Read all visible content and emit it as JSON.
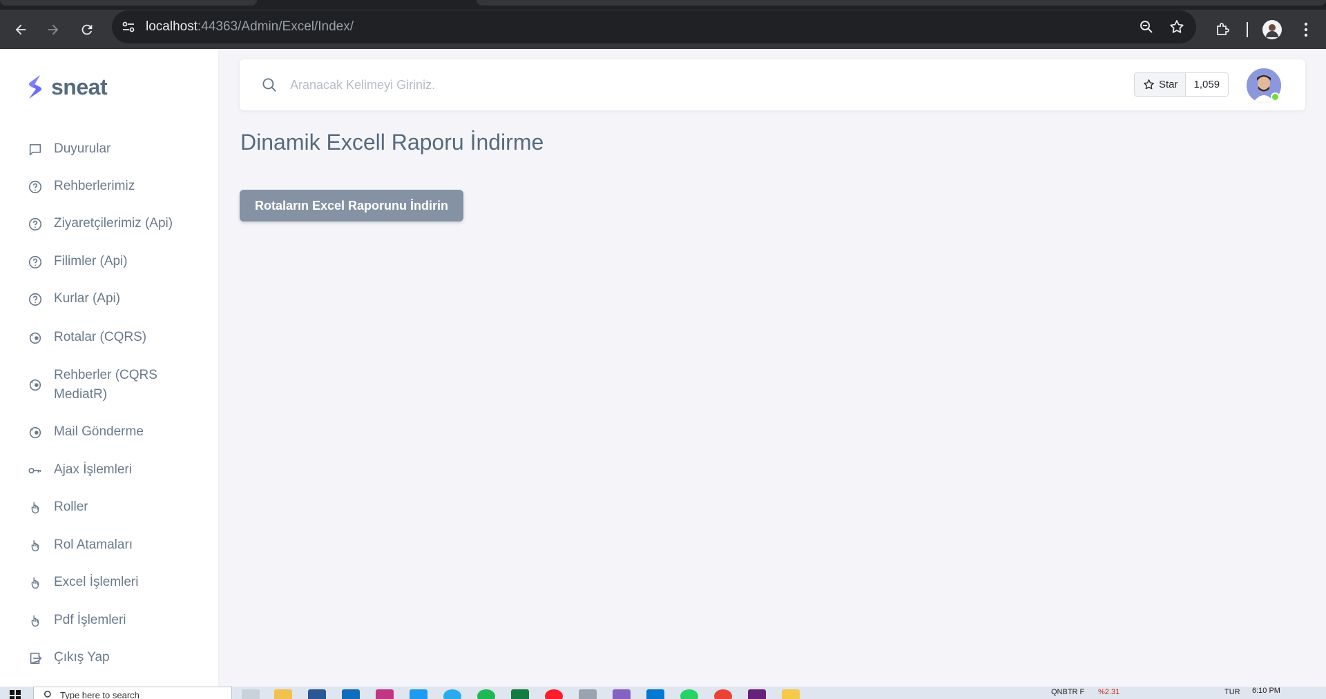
{
  "browser": {
    "url_host": "localhost",
    "url_path": ":44363/Admin/Excel/Index/"
  },
  "brand": {
    "name": "sneat",
    "color": "#696cff"
  },
  "menu": [
    {
      "label": "Duyurular",
      "icon": "message-square-icon"
    },
    {
      "label": "Rehberlerimiz",
      "icon": "help-circle-icon"
    },
    {
      "label": "Ziyaretçilerimiz (Api)",
      "icon": "help-circle-icon"
    },
    {
      "label": "Filimler (Api)",
      "icon": "help-circle-icon"
    },
    {
      "label": "Kurlar (Api)",
      "icon": "help-circle-icon"
    },
    {
      "label": "Rotalar (CQRS)",
      "icon": "mailchimp-icon"
    },
    {
      "label": "Rehberler (CQRS MediatR)",
      "icon": "mailchimp-icon"
    },
    {
      "label": "Mail Gönderme",
      "icon": "mailchimp-icon"
    },
    {
      "label": "Ajax İşlemleri",
      "icon": "key-icon"
    },
    {
      "label": "Roller",
      "icon": "hand-icon"
    },
    {
      "label": "Rol Atamaları",
      "icon": "hand-icon"
    },
    {
      "label": "Excel İşlemleri",
      "icon": "hand-icon"
    },
    {
      "label": "Pdf İşlemleri",
      "icon": "hand-icon"
    },
    {
      "label": "Çıkış Yap",
      "icon": "log-out-icon"
    }
  ],
  "navbar": {
    "search_placeholder": "Aranacak Kelimeyi Giriniz.",
    "star_label": "Star",
    "star_count": "1,059"
  },
  "main": {
    "title": "Dinamik Excell Raporu İndirme",
    "download_button": "Rotaların Excel Raporunu İndirin"
  },
  "taskbar": {
    "search_placeholder": "Type here to search",
    "tray_text": "QNBTR F",
    "tray_change": "%2.31",
    "lang": "TUR",
    "time": "6:10 PM"
  },
  "colors": {
    "primary_text": "#566a7f",
    "menu_text": "#697a8d",
    "button_secondary": "#8592a3",
    "background": "#f5f5f9"
  }
}
